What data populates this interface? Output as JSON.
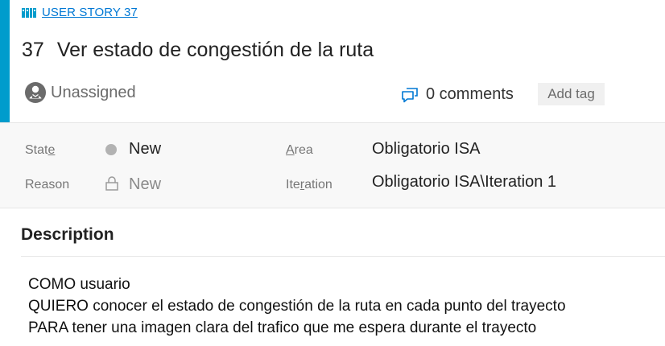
{
  "work_item": {
    "type_label": "USER STORY 37",
    "id": "37",
    "title": "Ver estado de congestión de la ruta",
    "assignee": "Unassigned",
    "comments_label": "0 comments",
    "add_tag_label": "Add tag"
  },
  "fields": {
    "state": {
      "label_pre": "Stat",
      "label_u": "e",
      "label_post": "",
      "value": "New"
    },
    "reason": {
      "label": "Reason",
      "value": "New"
    },
    "area": {
      "label_pre": "",
      "label_u": "A",
      "label_post": "rea",
      "value": "Obligatorio ISA"
    },
    "iteration": {
      "label_pre": "Ite",
      "label_u": "r",
      "label_post": "ation",
      "value": "Obligatorio ISA\\Iteration 1"
    }
  },
  "description": {
    "heading": "Description",
    "lines": [
      "COMO usuario",
      "QUIERO conocer el estado de congestión de la ruta en cada punto del trayecto",
      "PARA tener una imagen clara del trafico que me espera durante el trayecto"
    ]
  },
  "colors": {
    "accent": "#009ccc",
    "link": "#0078d4",
    "state_new": "#b2b2b2"
  },
  "icons": {
    "type": "book-icon",
    "assignee": "avatar-icon",
    "comments": "comments-icon",
    "reason": "lock-icon"
  }
}
